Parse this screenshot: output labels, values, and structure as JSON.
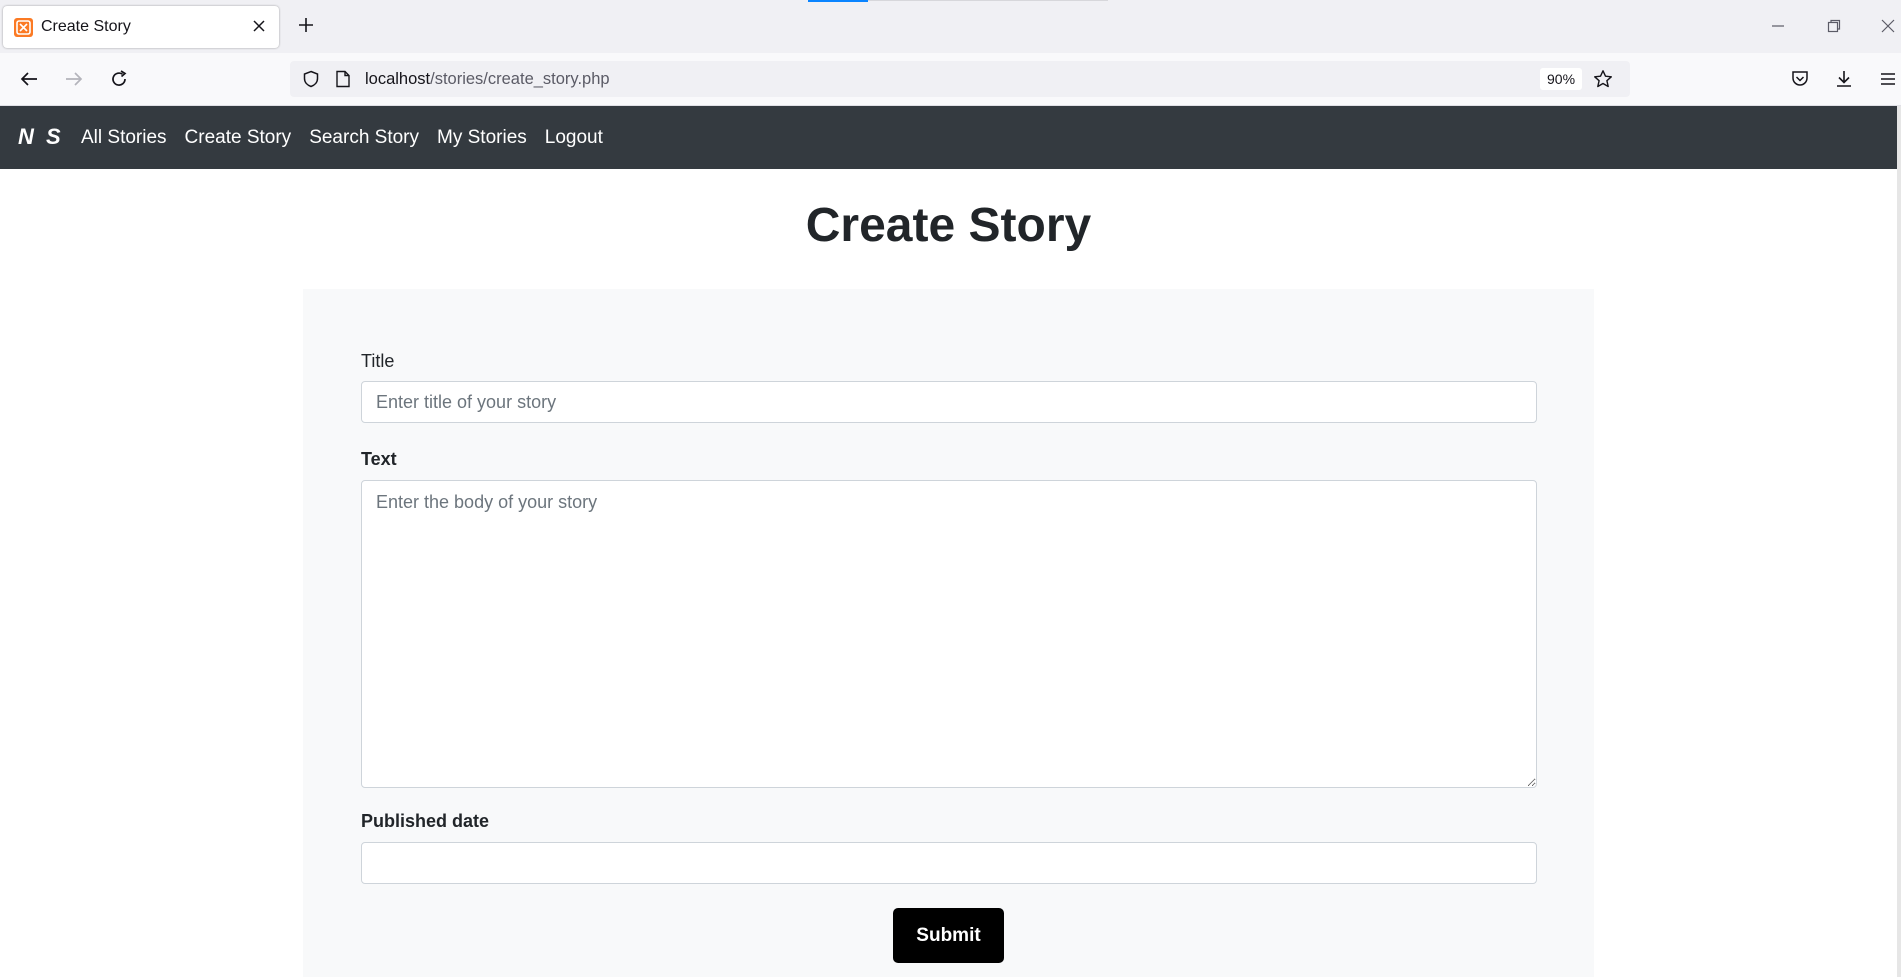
{
  "browser": {
    "tab_title": "Create Story",
    "url_host": "localhost",
    "url_path": "/stories/create_story.php",
    "zoom": "90%",
    "accent_color": "#0a84ff"
  },
  "site_nav": {
    "brand": "N S",
    "links": [
      "All Stories",
      "Create Story",
      "Search Story",
      "My Stories",
      "Logout"
    ],
    "background": "#343a40"
  },
  "page": {
    "title": "Create Story"
  },
  "form": {
    "title_label": "Title",
    "title_placeholder": "Enter title of your story",
    "title_value": "",
    "text_label": "Text",
    "text_placeholder": "Enter the body of your story",
    "text_value": "",
    "date_label": "Published date",
    "date_value": "",
    "submit_label": "Submit"
  }
}
